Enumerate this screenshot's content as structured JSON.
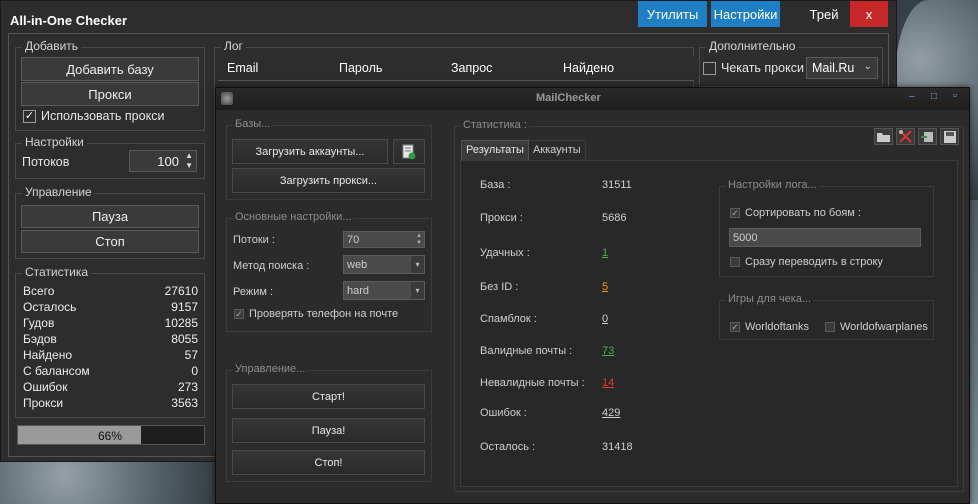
{
  "colors": {
    "accent_blue": "#1e7fc4",
    "close_red": "#c62828",
    "progress_fill": "#9a9a9a",
    "stat_green": "#4caf50",
    "stat_orange": "#ff8f00",
    "stat_red": "#e53935"
  },
  "main": {
    "title": "All-in-One Checker",
    "topbar": {
      "utilities": "Утилиты",
      "settings": "Настройки",
      "tray": "Трей",
      "close": "x"
    },
    "add": {
      "legend": "Добавить",
      "add_base": "Добавить базу",
      "proxy": "Прокси",
      "use_proxy": "Использовать прокси",
      "use_proxy_checked": true
    },
    "settings": {
      "legend": "Настройки",
      "threads_label": "Потоков",
      "threads_value": "100"
    },
    "control": {
      "legend": "Управление",
      "pause": "Пауза",
      "stop": "Стоп"
    },
    "stats": {
      "legend": "Статистика",
      "rows": [
        {
          "label": "Всего",
          "value": "27610"
        },
        {
          "label": "Осталось",
          "value": "9157"
        },
        {
          "label": "Гудов",
          "value": "10285"
        },
        {
          "label": "Бэдов",
          "value": "8055"
        },
        {
          "label": "Найдено",
          "value": "57"
        },
        {
          "label": "С балансом",
          "value": "0"
        },
        {
          "label": "Ошибок",
          "value": "273"
        },
        {
          "label": "Прокси",
          "value": "3563"
        }
      ],
      "progress_text": "66%",
      "progress_fraction": 0.66
    },
    "log": {
      "legend": "Лог",
      "columns": [
        "Email",
        "Пароль",
        "Запрос",
        "Найдено"
      ]
    },
    "extra": {
      "legend": "Дополнительно",
      "check_proxy": "Чекать прокси",
      "check_proxy_checked": false,
      "provider": "Mail.Ru"
    }
  },
  "mc": {
    "title": "MailChecker",
    "controls": {
      "minimize": "–",
      "maximize": "□",
      "close": "▫"
    },
    "bases": {
      "legend": "Базы...",
      "load_accounts": "Загрузить аккаунты...",
      "load_proxy": "Загрузить прокси...",
      "icon": "document-add-icon"
    },
    "main_settings": {
      "legend": "Основные настройки...",
      "threads_label": "Потоки :",
      "threads_value": "70",
      "search_label": "Метод поиска :",
      "search_value": "web",
      "mode_label": "Режим :",
      "mode_value": "hard",
      "check_phone": "Проверять телефон на почте",
      "check_phone_checked": true
    },
    "control": {
      "legend": "Управление...",
      "start": "Старт!",
      "pause": "Пауза!",
      "stop": "Стоп!"
    },
    "stats": {
      "legend": "Статистика :",
      "tabs": [
        "Результаты",
        "Аккаунты"
      ],
      "active_tab": "Результаты",
      "rows": [
        {
          "label": "База :",
          "value": "31511",
          "style": "plain"
        },
        {
          "label": "Прокси :",
          "value": "5686",
          "style": "plain"
        },
        {
          "label": "Удачных :",
          "value": "1",
          "style": "green"
        },
        {
          "label": "Без ID :",
          "value": "5",
          "style": "orange"
        },
        {
          "label": "Спамблок :",
          "value": "0",
          "style": "link"
        },
        {
          "label": "Валидные почты :",
          "value": "73",
          "style": "green"
        },
        {
          "label": "Невалидные почты :",
          "value": "14",
          "style": "red"
        },
        {
          "label": "Ошибок :",
          "value": "429",
          "style": "link"
        },
        {
          "label": "Осталось :",
          "value": "31418",
          "style": "plain"
        }
      ]
    },
    "toolbar_icons": [
      "folder-icon",
      "tools-icon",
      "export-icon",
      "save-icon"
    ],
    "log_settings": {
      "legend": "Настройки лога...",
      "sort_by_battles": "Сортировать по боям :",
      "sort_checked": true,
      "sort_value": "5000",
      "newline": "Сразу переводить в строку",
      "newline_checked": false
    },
    "games": {
      "legend": "Игры для чека...",
      "wot": "Worldoftanks",
      "wot_checked": true,
      "wowp": "Worldofwarplanes",
      "wowp_checked": false
    }
  }
}
